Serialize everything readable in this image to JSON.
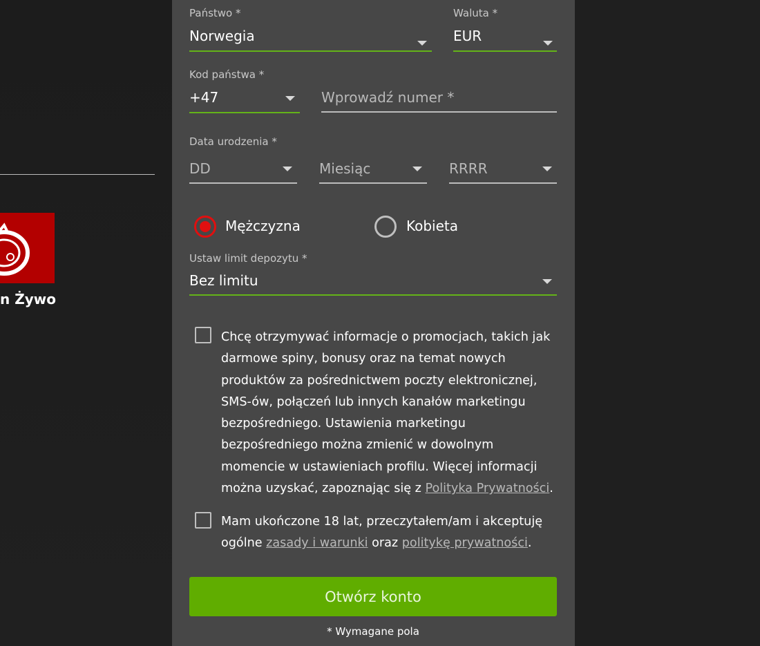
{
  "background": {
    "game_label": "n Żywo"
  },
  "form": {
    "country": {
      "label": "Państwo *",
      "value": "Norwegia"
    },
    "currency": {
      "label": "Waluta *",
      "value": "EUR"
    },
    "country_code": {
      "label": "Kod państwa *",
      "value": "+47"
    },
    "phone": {
      "placeholder": "Wprowadź numer *"
    },
    "birth_date": {
      "label": "Data urodzenia *",
      "day_placeholder": "DD",
      "month_placeholder": "Miesiąc",
      "year_placeholder": "RRRR"
    },
    "gender": {
      "male_label": "Mężczyzna",
      "female_label": "Kobieta",
      "selected": "male"
    },
    "deposit_limit": {
      "label": "Ustaw limit depozytu *",
      "value": "Bez limitu"
    },
    "marketing_consent": {
      "text_before": "Chcę otrzymywać informacje o promocjach, takich jak darmowe spiny, bonusy oraz na temat nowych produktów za pośrednictwem poczty elektronicznej, SMS-ów, połączeń lub innych kanałów marketingu bezpośredniego. Ustawienia marketingu bezpośredniego można zmienić w dowolnym momencie w ustawieniach profilu. Więcej informacji można uzyskać, zapoznając się z ",
      "link": "Polityka Prywatności",
      "text_after": ".",
      "checked": false
    },
    "terms_consent": {
      "text_before": "Mam ukończone 18 lat, przeczytałem/am i akceptuję ogólne ",
      "link_terms": "zasady i warunki",
      "text_middle": " oraz ",
      "link_privacy": "politykę prywatności",
      "text_after": ".",
      "checked": false
    },
    "submit_label": "Otwórz konto",
    "required_note": "* Wymagane pola"
  },
  "colors": {
    "accent_green": "#60ad00",
    "underline_green": "#64b418",
    "radio_red": "#e10f0f",
    "panel_bg": "#474747",
    "page_bg": "#1f1f1f"
  }
}
